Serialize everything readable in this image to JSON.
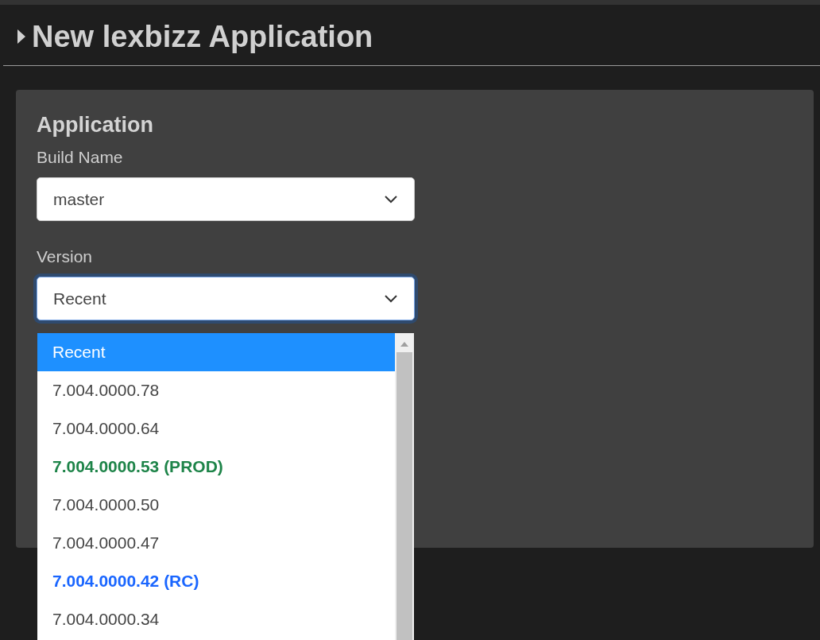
{
  "header": {
    "title": "New lexbizz Application"
  },
  "section": {
    "title": "Application"
  },
  "fields": [
    {
      "label": "Build Name",
      "value": "master",
      "focused": false
    },
    {
      "label": "Version",
      "value": "Recent",
      "focused": true
    }
  ],
  "dropdown": {
    "options": [
      {
        "label": "Recent",
        "kind": "plain",
        "selected": true
      },
      {
        "label": "7.004.0000.78",
        "kind": "plain",
        "selected": false
      },
      {
        "label": "7.004.0000.64",
        "kind": "plain",
        "selected": false
      },
      {
        "label": "7.004.0000.53 (PROD)",
        "kind": "prod",
        "selected": false
      },
      {
        "label": "7.004.0000.50",
        "kind": "plain",
        "selected": false
      },
      {
        "label": "7.004.0000.47",
        "kind": "plain",
        "selected": false
      },
      {
        "label": "7.004.0000.42 (RC)",
        "kind": "rc",
        "selected": false
      },
      {
        "label": "7.004.0000.34",
        "kind": "plain",
        "selected": false
      }
    ]
  }
}
